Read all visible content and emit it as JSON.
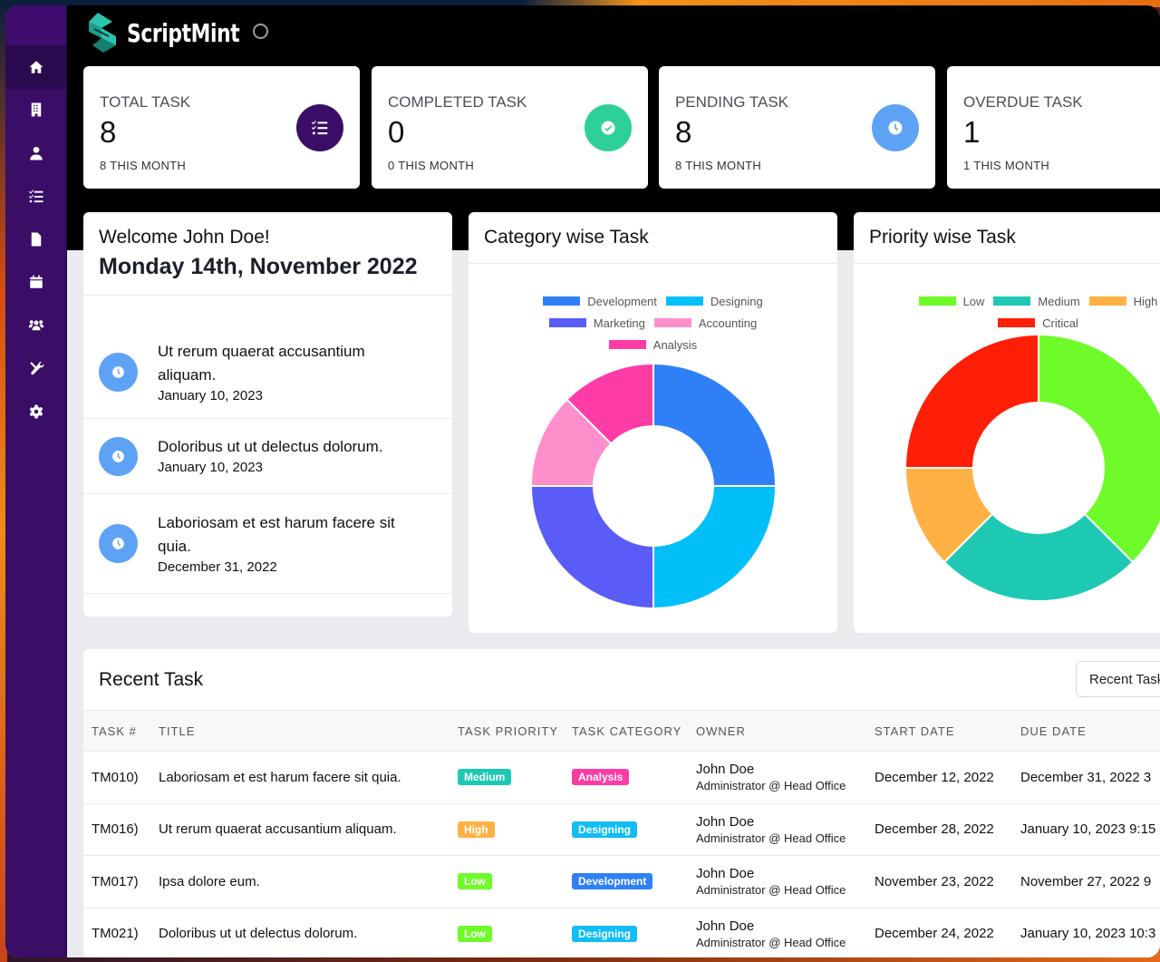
{
  "app": {
    "name": "ScriptMint"
  },
  "sidebar": {
    "items": [
      {
        "icon": "home-icon",
        "label": "Dashboard",
        "active": true
      },
      {
        "icon": "building-icon",
        "label": "Organization"
      },
      {
        "icon": "user-tie-icon",
        "label": "Employees"
      },
      {
        "icon": "tasks-icon",
        "label": "Tasks"
      },
      {
        "icon": "document-icon",
        "label": "Documents"
      },
      {
        "icon": "calendar-icon",
        "label": "Calendar"
      },
      {
        "icon": "users-icon",
        "label": "Teams"
      },
      {
        "icon": "tools-icon",
        "label": "Utilities"
      },
      {
        "icon": "gear-icon",
        "label": "Settings"
      }
    ]
  },
  "stats": [
    {
      "label": "TOTAL TASK",
      "value": "8",
      "sub": "8 THIS MONTH",
      "icon": "task-list-icon",
      "color": "#3a0d66"
    },
    {
      "label": "COMPLETED TASK",
      "value": "0",
      "sub": "0 THIS MONTH",
      "icon": "check-circle-icon",
      "color": "#2ed09a"
    },
    {
      "label": "PENDING TASK",
      "value": "8",
      "sub": "8 THIS MONTH",
      "icon": "clock-icon",
      "color": "#5ea2f5"
    },
    {
      "label": "OVERDUE TASK",
      "value": "1",
      "sub": "1 THIS MONTH",
      "icon": "alert-icon",
      "color": "#ff4b4b"
    }
  ],
  "welcome": {
    "greeting": "Welcome John Doe!",
    "date": "Monday 14th, November 2022",
    "events": [
      {
        "title": "Ut rerum quaerat accusantium aliquam.",
        "date": "January 10, 2023"
      },
      {
        "title": "Doloribus ut ut delectus dolorum.",
        "date": "January 10, 2023"
      },
      {
        "title": "Laboriosam et est harum facere sit quia.",
        "date": "December 31, 2022"
      }
    ]
  },
  "chart_data": [
    {
      "type": "pie",
      "title": "Category wise Task",
      "donut": true,
      "legend": "top",
      "categories": [
        "Development",
        "Designing",
        "Marketing",
        "Accounting",
        "Analysis"
      ],
      "values": [
        2,
        2,
        2,
        1,
        1
      ],
      "colors": [
        "#2f80f7",
        "#00bff9",
        "#5a5cf8",
        "#ff8fca",
        "#ff3ca6"
      ]
    },
    {
      "type": "pie",
      "title": "Priority wise Task",
      "donut": true,
      "legend": "top",
      "categories": [
        "Low",
        "Medium",
        "High",
        "Critical"
      ],
      "values": [
        3,
        2,
        1,
        2
      ],
      "colors": [
        "#6ffb2a",
        "#1dc9b2",
        "#ffb143",
        "#ff1f06"
      ]
    }
  ],
  "recent": {
    "title": "Recent Task",
    "button_label": "Recent Task",
    "columns": [
      "TASK #",
      "TITLE",
      "TASK PRIORITY",
      "TASK CATEGORY",
      "OWNER",
      "START DATE",
      "DUE DATE"
    ],
    "rows": [
      {
        "id": "TM010)",
        "title": "Laboriosam et est harum facere sit quia.",
        "priority": "Medium",
        "priority_color": "#1dc9b2",
        "category": "Analysis",
        "category_color": "#ff3ca6",
        "owner": "John Doe",
        "owner_role": "Administrator @ Head Office",
        "start": "December 12, 2022",
        "due": "December 31, 2022 3"
      },
      {
        "id": "TM016)",
        "title": "Ut rerum quaerat accusantium aliquam.",
        "priority": "High",
        "priority_color": "#ffb143",
        "category": "Designing",
        "category_color": "#10bdf6",
        "owner": "John Doe",
        "owner_role": "Administrator @ Head Office",
        "start": "December 28, 2022",
        "due": "January 10, 2023 9:15"
      },
      {
        "id": "TM017)",
        "title": "Ipsa dolore eum.",
        "priority": "Low",
        "priority_color": "#6ffb2a",
        "category": "Development",
        "category_color": "#2f80f7",
        "owner": "John Doe",
        "owner_role": "Administrator @ Head Office",
        "start": "November 23, 2022",
        "due": "November 27, 2022 9"
      },
      {
        "id": "TM021)",
        "title": "Doloribus ut ut delectus dolorum.",
        "priority": "Low",
        "priority_color": "#6ffb2a",
        "category": "Designing",
        "category_color": "#10bdf6",
        "owner": "John Doe",
        "owner_role": "Administrator @ Head Office",
        "start": "December 24, 2022",
        "due": "January 10, 2023 10:3"
      }
    ]
  }
}
